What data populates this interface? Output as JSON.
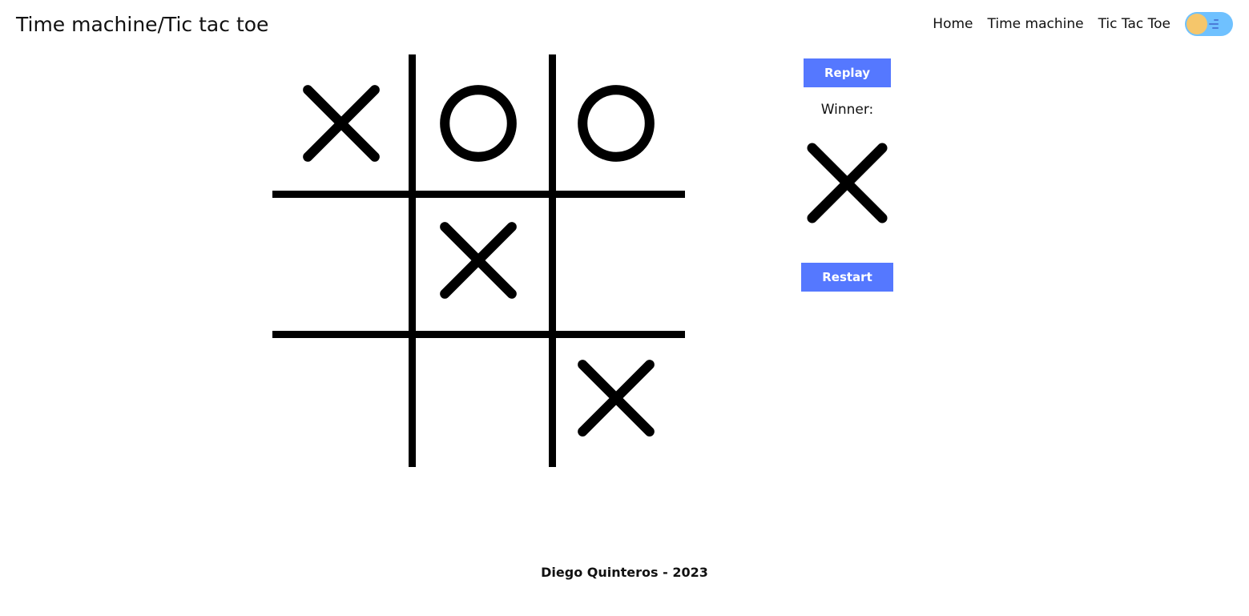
{
  "header": {
    "title": "Time machine/Tic tac toe",
    "nav": {
      "home": "Home",
      "time_machine": "Time machine",
      "tic_tac_toe": "Tic Tac Toe"
    }
  },
  "controls": {
    "replay": "Replay",
    "restart": "Restart",
    "winner_label": "Winner:"
  },
  "game": {
    "winner": "X",
    "board": [
      "X",
      "O",
      "O",
      "",
      "X",
      "",
      "",
      "",
      "X"
    ]
  },
  "footer": {
    "text": "Diego Quinteros - 2023"
  },
  "colors": {
    "button": "#5578ff",
    "toggle_bg": "#6fc1ff",
    "toggle_knob": "#f5c66b"
  }
}
